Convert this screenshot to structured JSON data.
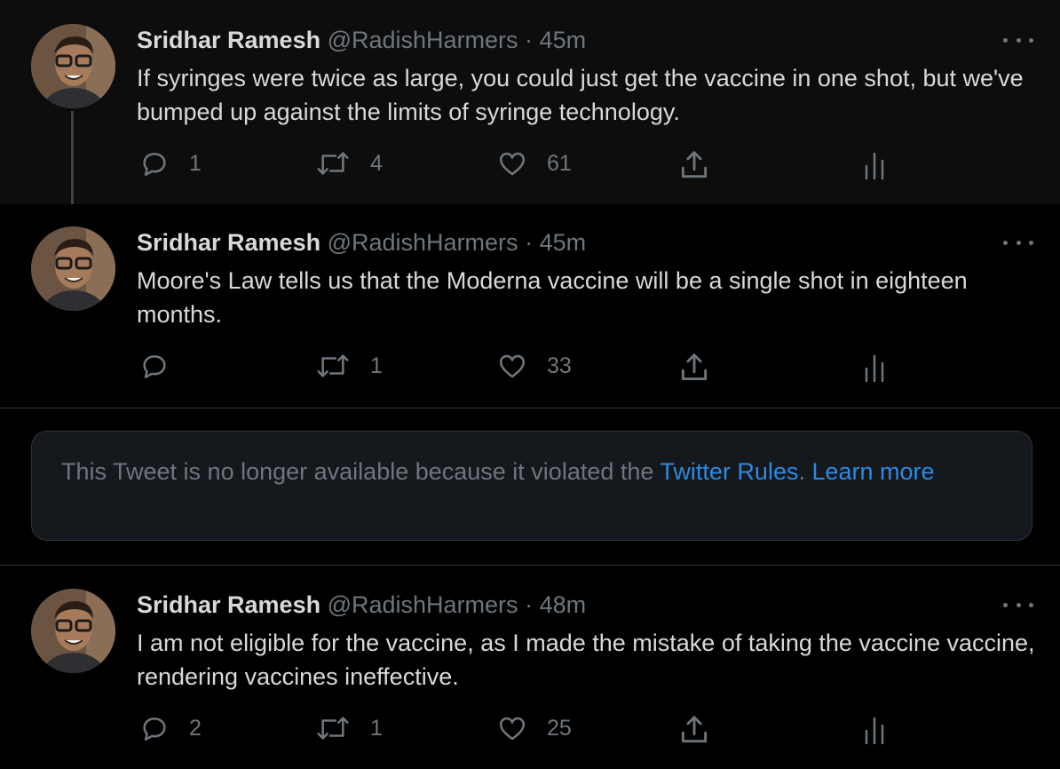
{
  "tweets": [
    {
      "author_name": "Sridhar Ramesh",
      "handle": "@RadishHarmers",
      "separator": "·",
      "time": "45m",
      "text": "If syringes were twice as large, you could just get the vaccine in one shot, but we've bumped up against the limits of syringe technology.",
      "replies": "1",
      "retweets": "4",
      "likes": "61"
    },
    {
      "author_name": "Sridhar Ramesh",
      "handle": "@RadishHarmers",
      "separator": "·",
      "time": "45m",
      "text": "Moore's Law tells us that the Moderna vaccine will be a single shot in eighteen months.",
      "replies": "",
      "retweets": "1",
      "likes": "33"
    },
    {
      "author_name": "Sridhar Ramesh",
      "handle": "@RadishHarmers",
      "separator": "·",
      "time": "48m",
      "text": "I am not eligible for the vaccine, as I made the mistake of taking the vaccine vaccine, rendering vaccines ineffective.",
      "replies": "2",
      "retweets": "1",
      "likes": "25"
    }
  ],
  "notice": {
    "prefix": "This Tweet is no longer available because it violated the ",
    "rules_link": "Twitter Rules",
    "period": ". ",
    "learn_more_link": "Learn more"
  },
  "icons": {
    "reply": "reply-icon",
    "retweet": "retweet-icon",
    "like": "heart-icon",
    "share": "share-icon",
    "analytics": "analytics-icon",
    "more": "more-icon"
  },
  "colors": {
    "background": "#000000",
    "thread_background": "#0d0d0d",
    "text": "#d9d9d9",
    "muted": "#6e767d",
    "link": "#2d8ae0",
    "notice_background": "#15181c",
    "border": "#2f3336"
  }
}
